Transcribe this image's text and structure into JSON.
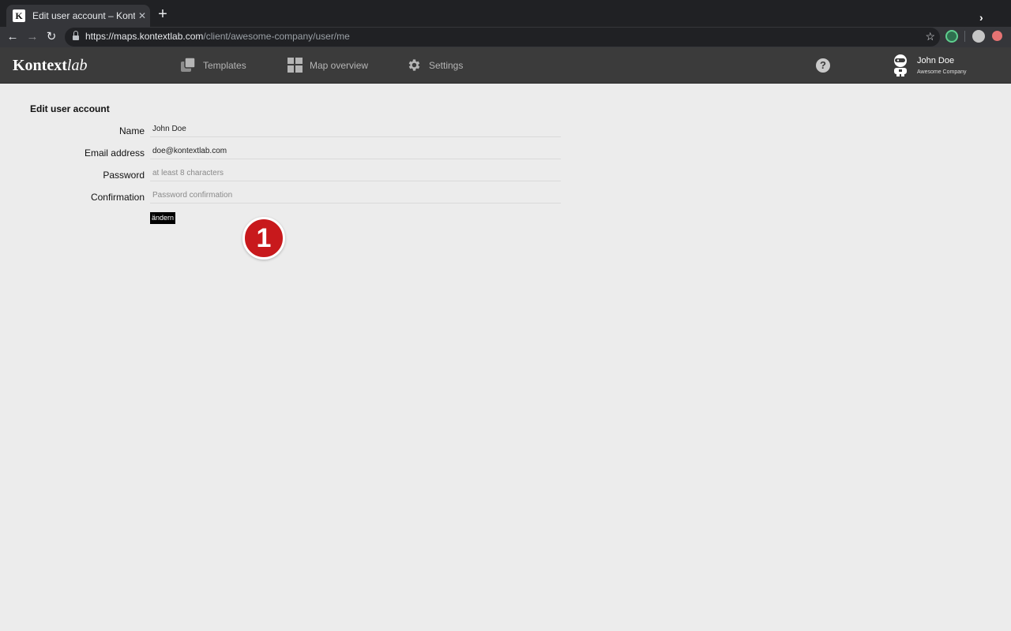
{
  "browser": {
    "tab_title": "Edit user account – Kontextlab",
    "favicon_letter": "K",
    "url_host": "https://maps.kontextlab.com",
    "url_path": "/client/awesome-company/user/me"
  },
  "header": {
    "logo_bold": "Kontext",
    "logo_italic": "lab",
    "nav": [
      {
        "label": "Templates",
        "icon": "templates-icon"
      },
      {
        "label": "Map overview",
        "icon": "grid-icon"
      },
      {
        "label": "Settings",
        "icon": "gear-icon"
      }
    ],
    "help_glyph": "?",
    "user": {
      "name": "John Doe",
      "company": "Awesome Company"
    }
  },
  "form": {
    "title": "Edit user account",
    "fields": [
      {
        "label": "Name",
        "value": "John Doe",
        "placeholder": ""
      },
      {
        "label": "Email address",
        "value": "doe@kontextlab.com",
        "placeholder": ""
      },
      {
        "label": "Password",
        "value": "",
        "placeholder": "at least 8 characters"
      },
      {
        "label": "Confirmation",
        "value": "",
        "placeholder": "Password confirmation"
      }
    ],
    "submit_label": "ändern"
  },
  "annotation": {
    "step_number": "1",
    "color": "#c8191c"
  },
  "colors": {
    "header_bg": "#3b3b3b",
    "page_bg": "#ececec",
    "chrome_bg": "#202124"
  }
}
